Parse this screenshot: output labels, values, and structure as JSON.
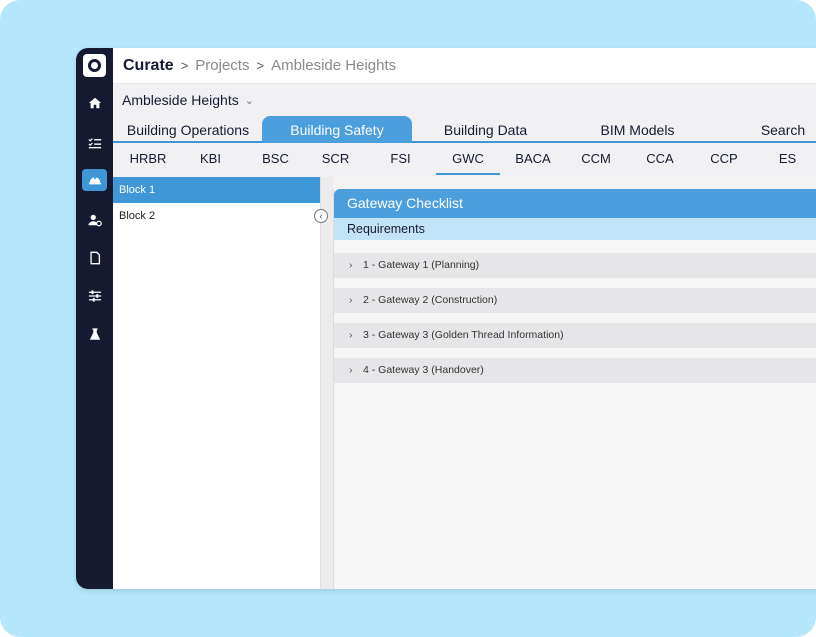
{
  "breadcrumb": {
    "app": "Curate",
    "separator": ">",
    "projects": "Projects",
    "current": "Ambleside Heights"
  },
  "project_selector": {
    "value": "Ambleside Heights",
    "chevron": "⌄"
  },
  "main_tabs": [
    {
      "label": "Building Operations",
      "active": false
    },
    {
      "label": "Building Safety",
      "active": true
    },
    {
      "label": "Building Data",
      "active": false
    },
    {
      "label": "BIM Models",
      "active": false
    },
    {
      "label": "Search",
      "active": false
    }
  ],
  "sub_tabs": [
    {
      "label": "HRBR"
    },
    {
      "label": "KBI"
    },
    {
      "label": "BSC"
    },
    {
      "label": "SCR"
    },
    {
      "label": "FSI"
    },
    {
      "label": "GWC",
      "active": true
    },
    {
      "label": "BACA"
    },
    {
      "label": "CCM"
    },
    {
      "label": "CCA"
    },
    {
      "label": "CCP"
    },
    {
      "label": "ES"
    }
  ],
  "blocks": [
    {
      "label": "Block 1",
      "active": true
    },
    {
      "label": "Block 2",
      "active": false
    }
  ],
  "collapse_glyph": "‹",
  "panel": {
    "title": "Gateway Checklist",
    "subtitle": "Requirements",
    "chevron": "›",
    "rows": [
      "1 - Gateway 1 (Planning)",
      "2 - Gateway 2 (Construction)",
      "3 - Gateway 3 (Golden Thread Information)",
      "4 - Gateway 3 (Handover)"
    ]
  },
  "rail_icons": [
    "home-icon",
    "checklist-icon",
    "hardhat-icon",
    "user-settings-icon",
    "document-icon",
    "sliders-icon",
    "flask-icon"
  ],
  "colors": {
    "accent": "#3f97d8",
    "rail": "#161a30",
    "background": "#b5e7fc",
    "subheader_band": "#c2e4f8"
  }
}
